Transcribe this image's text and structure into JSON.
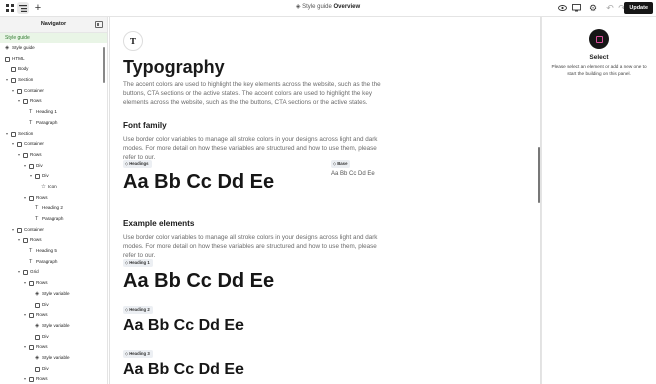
{
  "topbar": {
    "breadcrumb_prefix": "Style guide",
    "breadcrumb_page": "Overview",
    "update_label": "Update"
  },
  "navigator": {
    "title": "Navigator",
    "tag": "Style guide",
    "tree": [
      {
        "label": "Style guide",
        "depth": 0,
        "icon": "style-icon",
        "chev": false
      },
      {
        "label": "HTML",
        "depth": 0,
        "icon": "box",
        "chev": false
      },
      {
        "label": "Body",
        "depth": 1,
        "icon": "box",
        "chev": false
      },
      {
        "label": "Section",
        "depth": 1,
        "icon": "box",
        "chev": true
      },
      {
        "label": "Container",
        "depth": 2,
        "icon": "box",
        "chev": true
      },
      {
        "label": "Rows",
        "depth": 3,
        "icon": "box",
        "chev": true
      },
      {
        "label": "Heading 1",
        "depth": 4,
        "icon": "text",
        "chev": false
      },
      {
        "label": "Paragraph",
        "depth": 4,
        "icon": "text",
        "chev": false
      },
      {
        "label": "Section",
        "depth": 1,
        "icon": "box",
        "chev": true
      },
      {
        "label": "Container",
        "depth": 2,
        "icon": "box",
        "chev": true
      },
      {
        "label": "Rows",
        "depth": 3,
        "icon": "box",
        "chev": true
      },
      {
        "label": "Div",
        "depth": 4,
        "icon": "box",
        "chev": true
      },
      {
        "label": "Div",
        "depth": 5,
        "icon": "box",
        "chev": true
      },
      {
        "label": "Icon",
        "depth": 6,
        "icon": "star",
        "chev": false
      },
      {
        "label": "Rows",
        "depth": 4,
        "icon": "box",
        "chev": true
      },
      {
        "label": "Heading 2",
        "depth": 5,
        "icon": "text",
        "chev": false
      },
      {
        "label": "Paragraph",
        "depth": 5,
        "icon": "text",
        "chev": false
      },
      {
        "label": "Container",
        "depth": 2,
        "icon": "box",
        "chev": true
      },
      {
        "label": "Rows",
        "depth": 3,
        "icon": "box",
        "chev": true
      },
      {
        "label": "Heading 5",
        "depth": 4,
        "icon": "text",
        "chev": false
      },
      {
        "label": "Paragraph",
        "depth": 4,
        "icon": "text",
        "chev": false
      },
      {
        "label": "Grid",
        "depth": 3,
        "icon": "box",
        "chev": true
      },
      {
        "label": "Rows",
        "depth": 4,
        "icon": "box",
        "chev": true
      },
      {
        "label": "Style variable",
        "depth": 5,
        "icon": "style-icon",
        "chev": false
      },
      {
        "label": "Div",
        "depth": 5,
        "icon": "box",
        "chev": false
      },
      {
        "label": "Rows",
        "depth": 4,
        "icon": "box",
        "chev": true
      },
      {
        "label": "Style variable",
        "depth": 5,
        "icon": "style-icon",
        "chev": false
      },
      {
        "label": "Div",
        "depth": 5,
        "icon": "box",
        "chev": false
      },
      {
        "label": "Rows",
        "depth": 4,
        "icon": "box",
        "chev": true
      },
      {
        "label": "Style variable",
        "depth": 5,
        "icon": "style-icon",
        "chev": false
      },
      {
        "label": "Div",
        "depth": 5,
        "icon": "box",
        "chev": false
      },
      {
        "label": "Rows",
        "depth": 4,
        "icon": "box",
        "chev": true
      }
    ]
  },
  "page": {
    "logo_glyph": "T",
    "title": "Typography",
    "intro": "The accent colors are used to highlight the key elements across the website, such as the the buttons, CTA sections or the active states. The accent colors are used to highlight the key elements across the website, such as the the buttons, CTA sections or the active states.",
    "font_family": {
      "heading": "Font family",
      "desc": "Use border color variables to manage all stroke colors in your designs across light and dark modes. For more detail on how these variables are structured and how to use them, please refer to our.",
      "headings_badge": "Headings",
      "headings_sample": "Aa Bb Cc Dd Ee",
      "base_badge": "Base",
      "base_sample": "Aa Bb Cc Dd Ee"
    },
    "examples": {
      "heading": "Example elements",
      "desc": "Use border color variables to manage all stroke colors in your designs across light and dark modes. For more detail on how these variables are structured and how to use them, please refer to our.",
      "items": [
        {
          "badge": "Heading 1",
          "sample": "Aa Bb Cc Dd Ee"
        },
        {
          "badge": "Heading 2",
          "sample": "Aa Bb Cc Dd Ee"
        },
        {
          "badge": "Heading 3",
          "sample": "Aa Bb Cc Dd Ee"
        }
      ]
    }
  },
  "rightpanel": {
    "title": "Select",
    "desc": "Please select an element or add a new one to start the building on this panel."
  }
}
